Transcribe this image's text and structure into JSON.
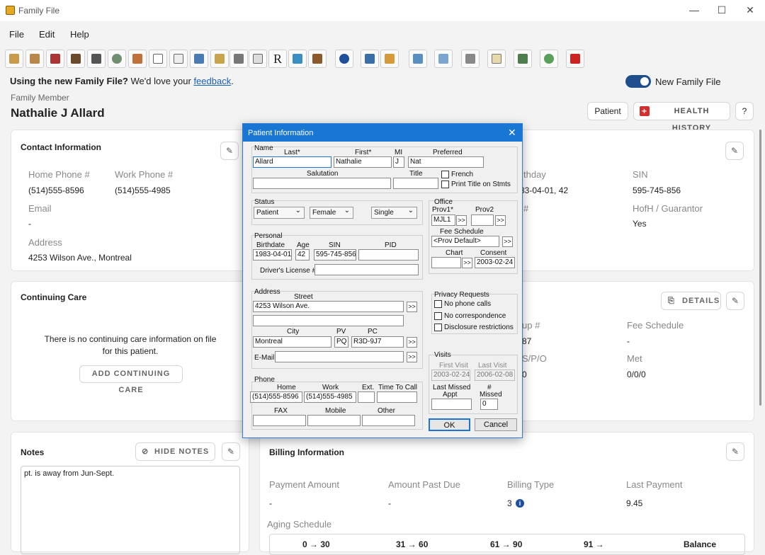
{
  "window": {
    "title": "Family File"
  },
  "menu": [
    "File",
    "Edit",
    "Help"
  ],
  "banner": {
    "prefix": "Using the new Family File?",
    "middle": " We'd love your ",
    "link": "feedback",
    "suffix": ".",
    "toggle_label": "New Family File"
  },
  "member": {
    "label": "Family Member",
    "name": "Nathalie J Allard",
    "patient_btn": "Patient",
    "health_btn": "HEALTH HISTORY",
    "help_btn": "?"
  },
  "contact": {
    "title": "Contact Information",
    "home_label": "Home Phone #",
    "home": "(514)555-8596",
    "work_label": "Work Phone #",
    "work": "(514)555-4985",
    "email_label": "Email",
    "email": "-",
    "address_label": "Address",
    "address": "4253 Wilson Ave., Montreal"
  },
  "right_info": {
    "birthday_label": "thday",
    "birthday": "83-04-01, 42",
    "hash_label": "#",
    "sin_label": "SIN",
    "sin": "595-745-856",
    "hofh_label": "HofH / Guarantor",
    "hofh": "Yes"
  },
  "care": {
    "title": "Continuing Care",
    "message": "There is no continuing care information on file for this patient.",
    "add_btn": "ADD CONTINUING CARE"
  },
  "insurance": {
    "details_btn": "DETAILS",
    "group_label": "up #",
    "group": "87",
    "fee_label": "Fee Schedule",
    "fee": "-",
    "spo_label": "S/P/O",
    "spo": "0",
    "met_label": "Met",
    "met": "0/0/0"
  },
  "notes": {
    "title": "Notes",
    "hide_btn": "HIDE NOTES",
    "text": "pt. is away from Jun-Sept."
  },
  "billing": {
    "title": "Billing Information",
    "payment_label": "Payment Amount",
    "payment": "-",
    "past_due_label": "Amount Past Due",
    "past_due": "-",
    "billing_type_label": "Billing Type",
    "billing_type": "3",
    "last_payment_label": "Last Payment",
    "last_payment": "9.45",
    "aging_label": "Aging Schedule",
    "aging_cols": [
      "0 → 30",
      "31 → 60",
      "61 → 90",
      "91 →",
      "Balance"
    ]
  },
  "dialog": {
    "title": "Patient Information",
    "name_grp": "Name",
    "last_l": "Last*",
    "first_l": "First*",
    "mi_l": "MI",
    "pref_l": "Preferred",
    "last": "Allard",
    "first": "Nathalie",
    "mi": "J",
    "pref": "Nat",
    "salutation_l": "Salutation",
    "title_l": "Title",
    "french": "French",
    "print_title": "Print Title on Stmts",
    "status_grp": "Status",
    "status": "Patient",
    "gender": "Female",
    "marital": "Single",
    "office_grp": "Office",
    "prov1_l": "Prov1*",
    "prov2_l": "Prov2",
    "prov1": "MJL1",
    "fee_l": "Fee Schedule",
    "fee": "<Prov Default>",
    "chart_l": "Chart",
    "consent_l": "Consent",
    "consent": "2003-02-24",
    "personal_grp": "Personal",
    "birth_l": "Birthdate",
    "age_l": "Age",
    "sin_l": "SIN",
    "pid_l": "PID",
    "birth": "1983-04-01",
    "age": "42",
    "sin": "595-745-856",
    "dl_l": "Driver's License #",
    "address_grp": "Address",
    "street_l": "Street",
    "street": "4253 Wilson Ave.",
    "city_l": "City",
    "pv_l": "PV",
    "pc_l": "PC",
    "city": "Montreal",
    "pv": "PQ",
    "pc": "R3D-9J7",
    "email_l": "E-Mail",
    "privacy_grp": "Privacy Requests",
    "no_phone": "No phone calls",
    "no_corr": "No correspondence",
    "disc": "Disclosure restrictions",
    "visits_grp": "Visits",
    "first_visit_l": "First Visit",
    "last_visit_l": "Last Visit",
    "first_visit": "2003-02-24",
    "last_visit": "2006-02-08",
    "last_missed_l1": "Last Missed",
    "last_missed_l2": "Appt",
    "missed_l1": "#",
    "missed_l2": "Missed",
    "missed": "0",
    "phone_grp": "Phone",
    "home_l": "Home",
    "work_l": "Work",
    "ext_l": "Ext.",
    "ttc_l": "Time To Call",
    "home": "(514)555-8596",
    "work": "(514)555-4985",
    "fax_l": "FAX",
    "mobile_l": "Mobile",
    "other_l": "Other",
    "ok": "OK",
    "cancel": "Cancel",
    "more": ">>"
  },
  "colors": {
    "accent": "#1f4e8c",
    "dialog_title": "#1976d2",
    "health": "#d32f2f",
    "link": "#1a5fb4"
  }
}
